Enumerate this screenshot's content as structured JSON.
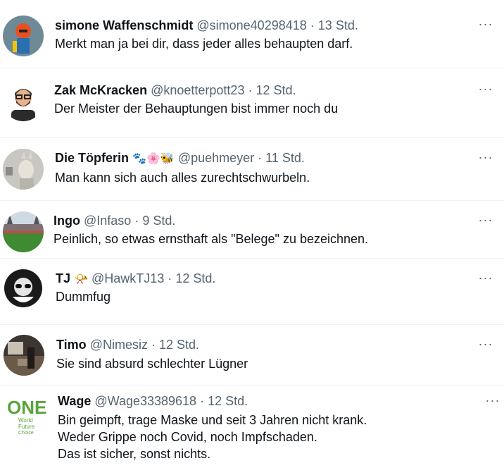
{
  "replies": [
    {
      "name": "simone Waffenschmidt",
      "handle": "@simone40298418",
      "sep": "·",
      "time": "13 Std.",
      "text": "Merkt man ja bei dir, dass jeder alles behaupten darf.",
      "more": "···"
    },
    {
      "name": "Zak McKracken",
      "handle": "@knoetterpott23",
      "sep": "·",
      "time": "12 Std.",
      "text": "Der Meister der Behauptungen bist immer noch du",
      "more": "···"
    },
    {
      "name": "Die Töpferin",
      "emoji": "🐾🌸🐝",
      "handle": "@puehmeyer",
      "sep": "·",
      "time": "11 Std.",
      "text": "Man kann sich auch alles zurechtschwurbeln.",
      "more": "···"
    },
    {
      "name": "Ingo",
      "handle": "@Infaso",
      "sep": "·",
      "time": "9 Std.",
      "text": "Peinlich, so etwas ernsthaft als \"Belege\" zu bezeichnen.",
      "more": "···"
    },
    {
      "name": "TJ",
      "emoji": "📯",
      "handle": "@HawkTJ13",
      "sep": "·",
      "time": "12 Std.",
      "text": "Dummfug",
      "more": "···"
    },
    {
      "name": "Timo",
      "handle": "@Nimesiz",
      "sep": "·",
      "time": "12 Std.",
      "text": "Sie sind absurd schlechter Lügner",
      "more": "···"
    },
    {
      "name": "Wage",
      "handle": "@Wage33389618",
      "sep": "·",
      "time": "12 Std.",
      "text": "Bin geimpft, trage Maske und seit 3 Jahren nicht krank.\nWeder Grippe noch Covid, noch Impfschaden.\nDas ist sicher, sonst nichts.",
      "more": "···"
    }
  ],
  "avatar_logo": {
    "big": "ONE",
    "small1": "World",
    "small2": "Future",
    "small3": "Choice"
  },
  "colors": {
    "text": "#0f1419",
    "secondary": "#536471",
    "divider": "#eff3f4",
    "logo_green": "#5aa53a"
  }
}
